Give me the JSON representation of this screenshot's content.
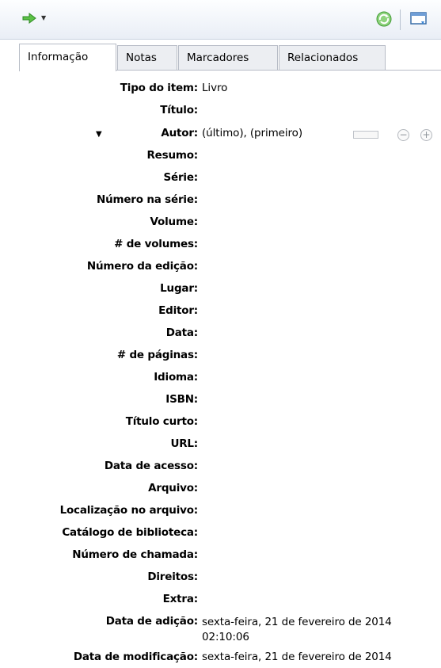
{
  "toolbar": {
    "back_forward_icon": "green-arrow-icon",
    "dropdown_icon": "caret-down-icon",
    "refresh_icon": "sync-icon",
    "new_window_icon": "new-window-icon"
  },
  "tabs": [
    {
      "label": "Informação",
      "active": true
    },
    {
      "label": "Notas"
    },
    {
      "label": "Marcadores"
    },
    {
      "label": "Relacionados"
    }
  ],
  "fields": [
    {
      "label": "Tipo do item:",
      "value": "Livro"
    },
    {
      "label": "Título:",
      "value": ""
    },
    {
      "label": "Autor:",
      "value": "(último), (primeiro)"
    },
    {
      "label": "Resumo:",
      "value": ""
    },
    {
      "label": "Série:",
      "value": ""
    },
    {
      "label": "Número na série:",
      "value": ""
    },
    {
      "label": "Volume:",
      "value": ""
    },
    {
      "label": "# de volumes:",
      "value": ""
    },
    {
      "label": "Número da edição:",
      "value": ""
    },
    {
      "label": "Lugar:",
      "value": ""
    },
    {
      "label": "Editor:",
      "value": ""
    },
    {
      "label": "Data:",
      "value": ""
    },
    {
      "label": "# de páginas:",
      "value": ""
    },
    {
      "label": "Idioma:",
      "value": ""
    },
    {
      "label": "ISBN:",
      "value": ""
    },
    {
      "label": "Título curto:",
      "value": ""
    },
    {
      "label": "URL:",
      "value": ""
    },
    {
      "label": "Data de acesso:",
      "value": ""
    },
    {
      "label": "Arquivo:",
      "value": ""
    },
    {
      "label": "Localização no arquivo:",
      "value": ""
    },
    {
      "label": "Catálogo de biblioteca:",
      "value": ""
    },
    {
      "label": "Número de chamada:",
      "value": ""
    },
    {
      "label": "Direitos:",
      "value": ""
    },
    {
      "label": "Extra:",
      "value": ""
    },
    {
      "label": "Data de adição:",
      "value": "sexta-feira, 21 de fevereiro de 2014 02:10:06"
    },
    {
      "label": "Data de modificação:",
      "value": "sexta-feira, 21 de fevereiro de 2014"
    }
  ],
  "author_controls": {
    "remove_label": "−",
    "add_label": "+"
  }
}
